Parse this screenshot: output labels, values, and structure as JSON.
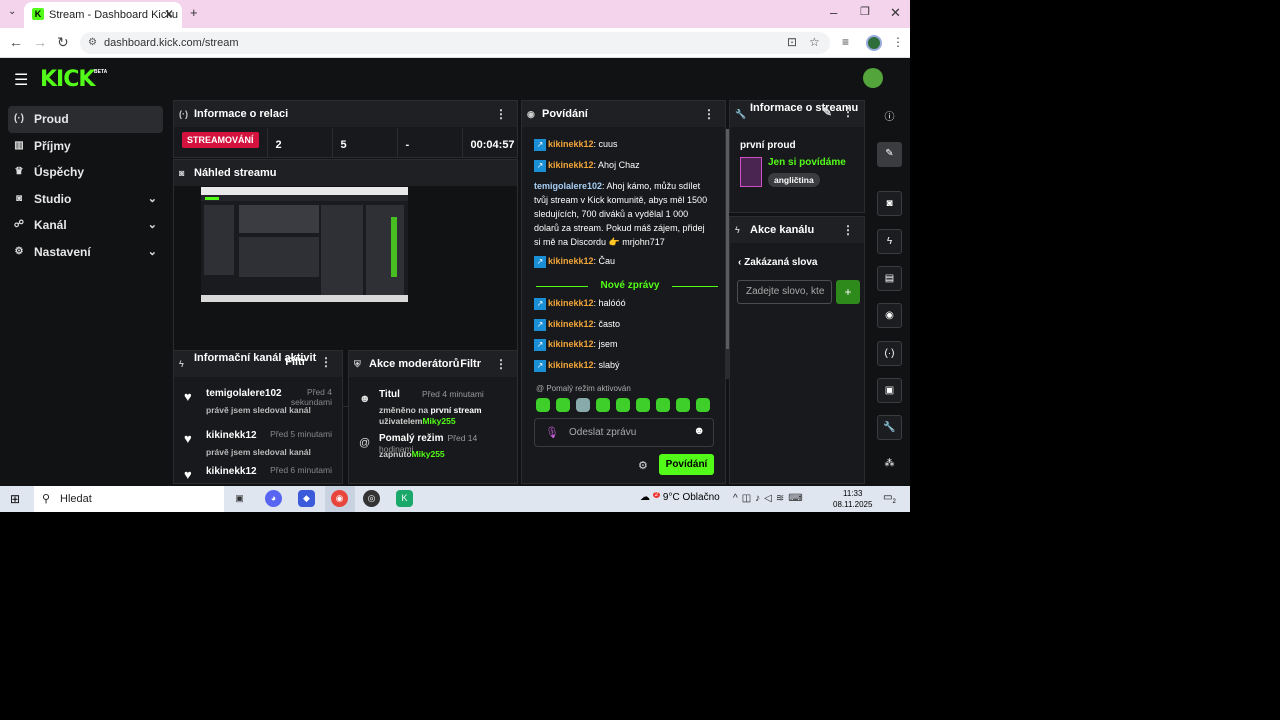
{
  "browser": {
    "tab_title": "Stream - Dashboard Kicku",
    "tab_icon": "kick-favicon",
    "url": "dashboard.kick.com/stream"
  },
  "app": {
    "logo": "KICK",
    "logo_badge": "BETA",
    "accent_color": "#53fc18"
  },
  "sidebar": {
    "items": [
      {
        "label": "Proud",
        "icon": "broadcast-icon",
        "active": true
      },
      {
        "label": "Příjmy",
        "icon": "chart-icon"
      },
      {
        "label": "Úspěchy",
        "icon": "trophy-icon"
      },
      {
        "label": "Studio",
        "icon": "camera-icon",
        "expandable": true
      },
      {
        "label": "Kanál",
        "icon": "users-icon",
        "expandable": true
      },
      {
        "label": "Nastavení",
        "icon": "gear-icon",
        "expandable": true
      }
    ]
  },
  "session": {
    "title": "Informace o relaci",
    "status": "STREAMOVÁNÍ",
    "stat1": "2",
    "stat2": "5",
    "stat3": "-",
    "duration": "00:04:57"
  },
  "preview": {
    "title": "Náhled streamu"
  },
  "activity": {
    "title": "Informační kanál aktivit",
    "filter": "Filtr",
    "items": [
      {
        "name": "temigolalere102",
        "time": "Před 4 sekundami",
        "desc": "právě jsem sledoval kanál"
      },
      {
        "name": "kikinekk12",
        "time": "Před 5 minutami",
        "desc": "právě jsem sledoval kanál"
      },
      {
        "name": "kikinekk12",
        "time": "Před 6 minutami",
        "desc": ""
      }
    ]
  },
  "mod_actions": {
    "title": "Akce moderátorů",
    "filter": "Filtr",
    "items": [
      {
        "title": "Titul",
        "time": "Před 4 minutami",
        "line1_prefix": "změněno na ",
        "line1_value": "první stream",
        "line2_prefix": "uživatelem",
        "user": "Miky255"
      },
      {
        "title": "Pomalý režim",
        "time": "Před 14 hodinami",
        "line1_prefix": "zapnuto",
        "user": "Miky255"
      }
    ]
  },
  "chat": {
    "title": "Povídání",
    "messages": [
      {
        "user": "kikinekk12",
        "text": ": cuus"
      },
      {
        "user": "kikinekk12",
        "text": ": Ahoj Chaz"
      },
      {
        "user": "temigolalere102",
        "text": ": Ahoj kámo, můžu sdílet tvůj stream v Kick komunitě, abys měl 1500 sledujících, 700 diváků a vydělal 1 000 dolarů za stream. Pokud máš zájem, přidej si mě na Discordu 👉 mrjohn717"
      },
      {
        "user": "kikinekk12",
        "text": ": Čau"
      },
      {
        "user": "kikinekk12",
        "text": ": halóóó"
      },
      {
        "user": "kikinekk12",
        "text": ": často"
      },
      {
        "user": "kikinekk12",
        "text": ": jsem"
      },
      {
        "user": "kikinekk12",
        "text": ": slabý"
      }
    ],
    "new_messages_label": "Nové zprávy",
    "slow_mode_notice": "Pomalý režim aktivován",
    "input_placeholder": "Odeslat zprávu",
    "send_label": "Povídání"
  },
  "stream_info": {
    "title": "Informace o streamu",
    "stream_title": "první proud",
    "category": "Jen si povídáme",
    "tag": "angličtina"
  },
  "channel_actions": {
    "title": "Akce kanálu",
    "section": "Zakázaná slova",
    "input_placeholder": "Zadejte slovo, kte",
    "add_label": "+"
  },
  "taskbar": {
    "search_placeholder": "Hledat",
    "weather": "9°C  Oblačno",
    "weather_badge": "2",
    "time": "11:33",
    "date": "08.11.2025",
    "notif_count": "2"
  }
}
